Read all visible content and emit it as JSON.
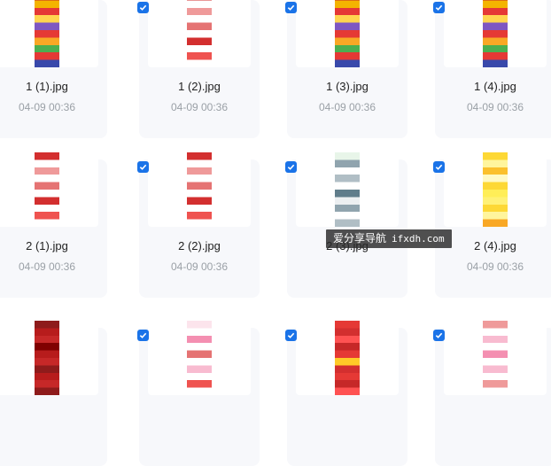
{
  "files": [
    {
      "name": "1 (1).jpg",
      "date": "04-09 00:36",
      "checked": true,
      "theme": "red-gold"
    },
    {
      "name": "1 (2).jpg",
      "date": "04-09 00:36",
      "checked": true,
      "theme": "red-white"
    },
    {
      "name": "1 (3).jpg",
      "date": "04-09 00:36",
      "checked": true,
      "theme": "red-gold"
    },
    {
      "name": "1 (4).jpg",
      "date": "04-09 00:36",
      "checked": true,
      "theme": "red-gold"
    },
    {
      "name": "2 (1).jpg",
      "date": "04-09 00:36",
      "checked": true,
      "theme": "red-white"
    },
    {
      "name": "2 (2).jpg",
      "date": "04-09 00:36",
      "checked": true,
      "theme": "red-white"
    },
    {
      "name": "2 (3).jpg",
      "date": "",
      "checked": true,
      "theme": "green-white"
    },
    {
      "name": "2 (4).jpg",
      "date": "04-09 00:36",
      "checked": true,
      "theme": "yellow"
    },
    {
      "name": "",
      "date": "",
      "checked": true,
      "theme": "dark-red"
    },
    {
      "name": "",
      "date": "",
      "checked": true,
      "theme": "pink-white"
    },
    {
      "name": "",
      "date": "",
      "checked": true,
      "theme": "bright-red"
    },
    {
      "name": "",
      "date": "",
      "checked": true,
      "theme": "pink-grid"
    }
  ],
  "watermark": {
    "cn": "爱分享导航",
    "url": "ifxdh.com"
  },
  "colors": {
    "accent": "#1a73e8",
    "card_bg": "#f7f8fb",
    "date": "#9aa0a6"
  }
}
